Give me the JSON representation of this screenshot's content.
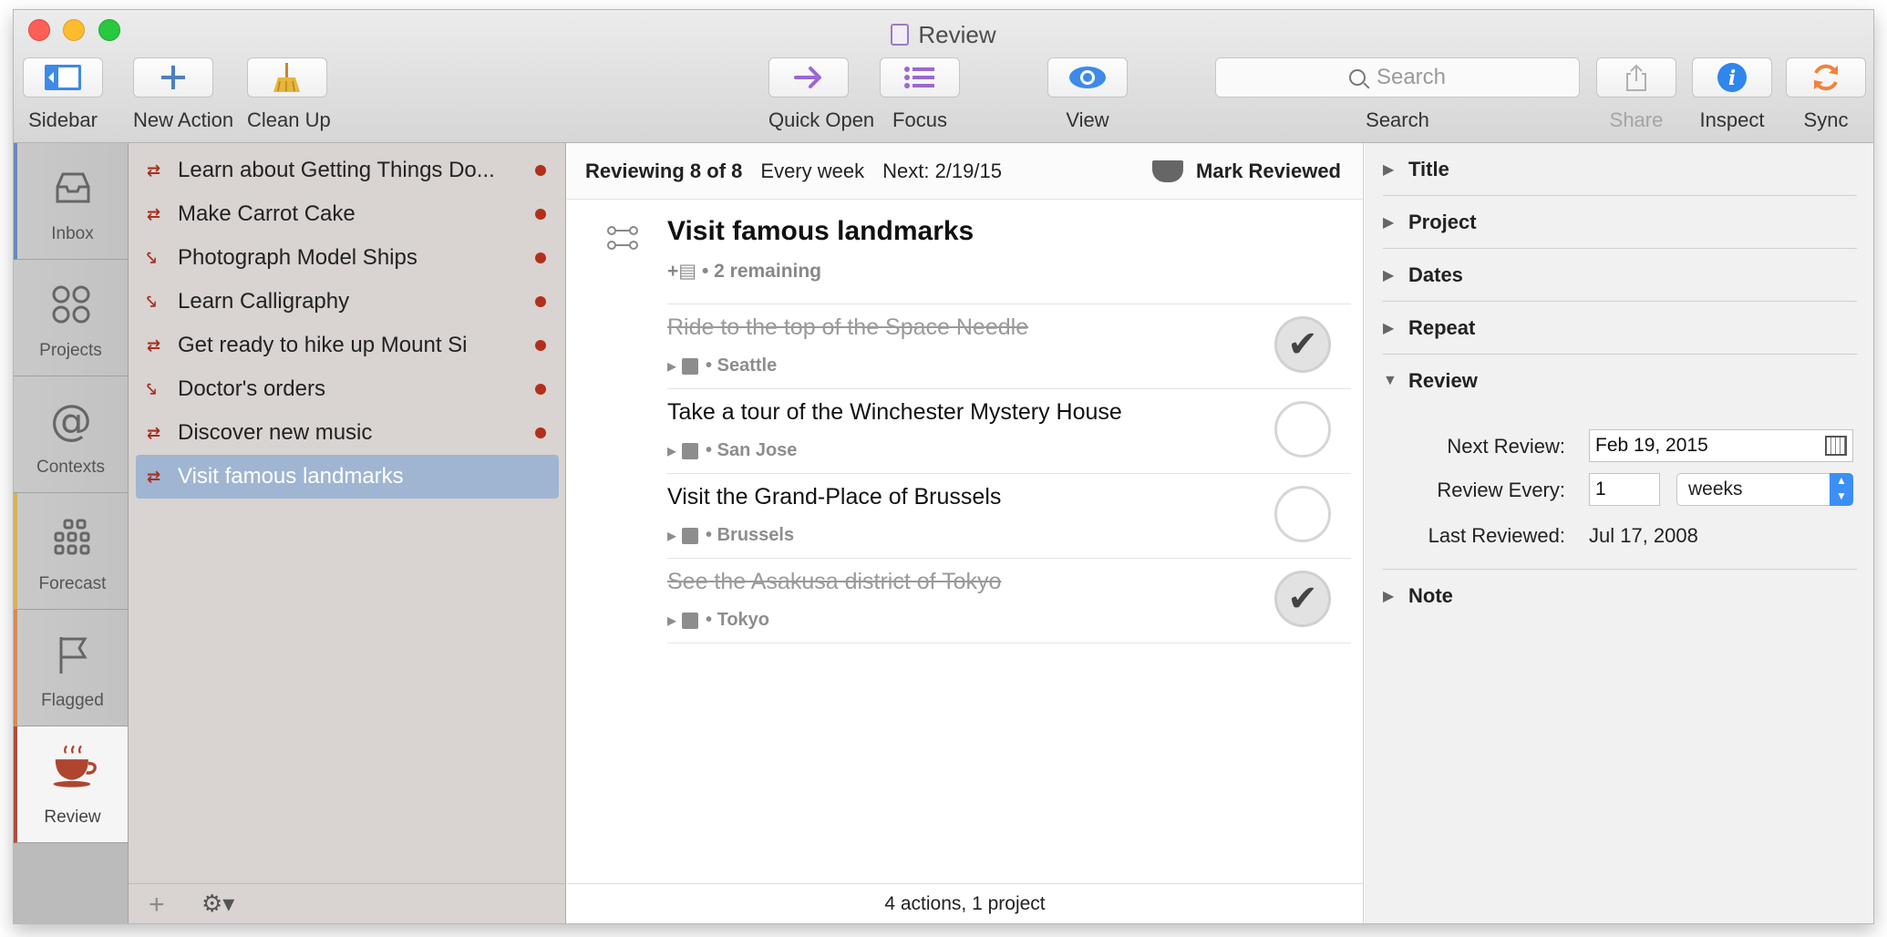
{
  "window": {
    "title": "Review"
  },
  "toolbar": {
    "sidebar": "Sidebar",
    "new_action": "New Action",
    "clean_up": "Clean Up",
    "quick_open": "Quick Open",
    "focus": "Focus",
    "view": "View",
    "search_placeholder": "Search",
    "search_label": "Search",
    "share": "Share",
    "inspect": "Inspect",
    "sync": "Sync"
  },
  "perspectives": [
    {
      "label": "Inbox",
      "icon": "inbox-icon"
    },
    {
      "label": "Projects",
      "icon": "projects-icon"
    },
    {
      "label": "Contexts",
      "icon": "at-sign-icon"
    },
    {
      "label": "Forecast",
      "icon": "grid-icon"
    },
    {
      "label": "Flagged",
      "icon": "flag-icon"
    },
    {
      "label": "Review",
      "icon": "coffee-cup-icon"
    }
  ],
  "sidebar": {
    "projects": [
      {
        "name": "Learn about Getting Things Do...",
        "type": "parallel"
      },
      {
        "name": "Make Carrot Cake",
        "type": "parallel"
      },
      {
        "name": "Photograph Model Ships",
        "type": "sequential"
      },
      {
        "name": "Learn Calligraphy",
        "type": "sequential"
      },
      {
        "name": "Get ready to hike up Mount Si",
        "type": "parallel"
      },
      {
        "name": "Doctor's orders",
        "type": "sequential"
      },
      {
        "name": "Discover new music",
        "type": "parallel"
      },
      {
        "name": "Visit famous landmarks",
        "type": "parallel"
      }
    ]
  },
  "review_bar": {
    "reviewing": "Reviewing 8 of 8",
    "interval": "Every week",
    "next": "Next: 2/19/15",
    "mark_reviewed": "Mark Reviewed"
  },
  "project": {
    "title": "Visit famous landmarks",
    "remaining": "• 2 remaining"
  },
  "tasks": [
    {
      "name": "Ride to the top of the Space Needle",
      "context": "• Seattle",
      "done": true
    },
    {
      "name": "Take a tour of the Winchester Mystery House",
      "context": "• San Jose",
      "done": false
    },
    {
      "name": "Visit the Grand-Place of Brussels",
      "context": "• Brussels",
      "done": false
    },
    {
      "name": "See the Asakusa district of Tokyo",
      "context": "• Tokyo",
      "done": true
    }
  ],
  "main_footer": "4 actions, 1 project",
  "inspector": {
    "sections": [
      "Title",
      "Project",
      "Dates",
      "Repeat",
      "Review",
      "Note"
    ],
    "next_review_label": "Next Review:",
    "next_review_value": "Feb 19, 2015",
    "review_every_label": "Review Every:",
    "review_every_value": "1",
    "review_every_unit": "weeks",
    "last_reviewed_label": "Last Reviewed:",
    "last_reviewed_value": "Jul 17, 2008"
  }
}
